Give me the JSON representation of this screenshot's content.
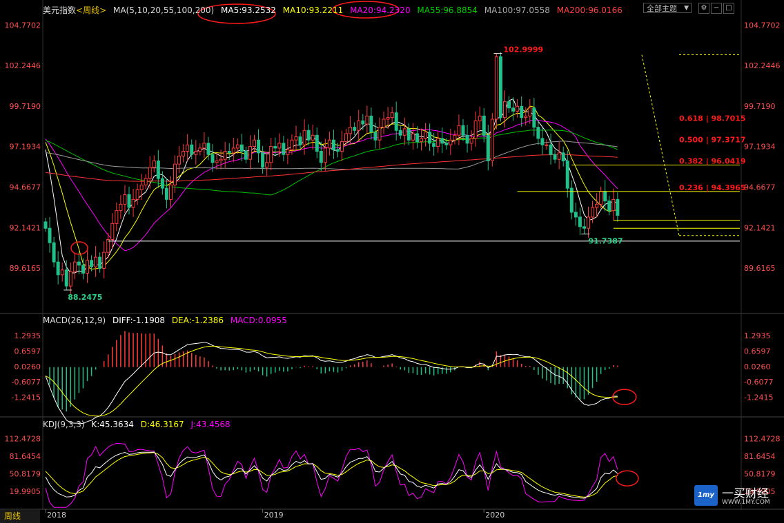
{
  "header": {
    "title": "美元指数",
    "period": "<周线>",
    "ma_label": "MA(5,10,20,55,100,200)",
    "ma5": "MA5:93.2532",
    "ma10": "MA10:93.2211",
    "ma20": "MA20:94.2320",
    "ma55": "MA55:96.8854",
    "ma100": "MA100:97.0558",
    "ma200": "MA200:96.0166",
    "theme_button": "全部主题"
  },
  "macd_header": {
    "label": "MACD(26,12,9)",
    "diff": "DIFF:-1.1908",
    "dea": "DEA:-1.2386",
    "macd": "MACD:0.0955"
  },
  "kdj_header": {
    "label": "KDJ(9,3,3)",
    "k": "K:45.3634",
    "d": "D:46.3167",
    "j": "J:43.4568"
  },
  "footer": {
    "period_tab": "周线",
    "logo_name": "一买财经",
    "logo_url": "WWW.1MY.COM",
    "logo_mark": "1my"
  },
  "colors": {
    "up": "#ff3b3b",
    "down": "#21c08b",
    "ma5": "#ffffff",
    "ma10": "#ffff00",
    "ma20": "#ff00ff",
    "ma55": "#00c000",
    "ma100": "#999999",
    "ma200": "#ff3333",
    "fib": "#ffff00",
    "highlight": "#ff1a1a"
  },
  "chart_data": [
    {
      "type": "candlestick",
      "name_label": "美元指数",
      "ylim": [
        87.0,
        105.3
      ],
      "y_ticks": [
        "104.7702",
        "102.2446",
        "99.7190",
        "97.1934",
        "94.6677",
        "92.1421",
        "89.6165"
      ],
      "y_tick_values": [
        104.7702,
        102.2446,
        99.719,
        97.1934,
        94.6677,
        92.1421,
        89.6165
      ],
      "x_ticks": [
        "2018",
        "2019",
        "2020"
      ],
      "x_tick_index": [
        0,
        52,
        105
      ],
      "high_label": "102.9999",
      "low_label_1": "88.2475",
      "low_label_2": "91.7387",
      "fib_levels": [
        {
          "label": "0.618",
          "value": "98.7015"
        },
        {
          "label": "0.500",
          "value": "97.3717"
        },
        {
          "label": "0.382",
          "value": "96.0419"
        },
        {
          "label": "0.236",
          "value": "94.3965"
        }
      ],
      "horizontal_levels": [
        91.3,
        92.1,
        92.6
      ],
      "ohlc_path": [
        92.1,
        91.2,
        90.0,
        89.2,
        89.5,
        88.5,
        89.4,
        90.0,
        89.8,
        89.3,
        90.1,
        89.7,
        90.3,
        89.6,
        90.6,
        91.4,
        92.4,
        93.2,
        93.6,
        94.2,
        93.4,
        93.9,
        94.5,
        94.8,
        95.2,
        95.9,
        96.3,
        95.2,
        94.6,
        93.9,
        94.8,
        96.1,
        96.6,
        96.9,
        97.3,
        96.7,
        96.9,
        97.1,
        97.4,
        96.7,
        96.2,
        96.3,
        96.4,
        96.9,
        96.8,
        97.1,
        97.3,
        96.9,
        96.4,
        97.2,
        97.6,
        96.8,
        95.9,
        96.2,
        97.2,
        97.1,
        97.4,
        96.7,
        97.0,
        97.6,
        97.8,
        97.3,
        98.2,
        97.6,
        97.9,
        96.9,
        96.2,
        97.1,
        97.6,
        97.0,
        96.9,
        97.5,
        98.0,
        98.4,
        98.2,
        98.8,
        98.6,
        99.1,
        98.1,
        97.6,
        98.4,
        98.9,
        99.0,
        99.3,
        98.2,
        97.9,
        98.3,
        97.6,
        98.0,
        97.5,
        97.7,
        98.1,
        97.4,
        97.2,
        97.7,
        97.4,
        97.3,
        97.6,
        97.9,
        98.5,
        97.9,
        97.4,
        97.7,
        98.8,
        99.1,
        97.9,
        96.3,
        98.9,
        102.8,
        99.0,
        100.0,
        99.6,
        99.4,
        99.7,
        99.0,
        99.1,
        99.6,
        98.4,
        97.7,
        97.3,
        97.3,
        96.7,
        96.4,
        96.8,
        96.3,
        94.6,
        93.1,
        92.8,
        92.2,
        92.1,
        92.8,
        93.4,
        93.6,
        94.4,
        93.8,
        93.2,
        93.9,
        92.9
      ]
    },
    {
      "type": "macd",
      "y_ticks": [
        "1.2935",
        "0.6597",
        "0.0260",
        "-0.6077",
        "-1.2415"
      ],
      "y_tick_values": [
        1.2935,
        0.6597,
        0.026,
        -0.6077,
        -1.2415
      ],
      "ylim": [
        -1.9,
        1.6
      ]
    },
    {
      "type": "kdj",
      "y_ticks": [
        "112.4728",
        "81.6454",
        "50.8179",
        "19.9905"
      ],
      "y_tick_values": [
        112.4728,
        81.6454,
        50.8179,
        19.9905
      ],
      "ylim": [
        -10,
        125
      ]
    }
  ]
}
